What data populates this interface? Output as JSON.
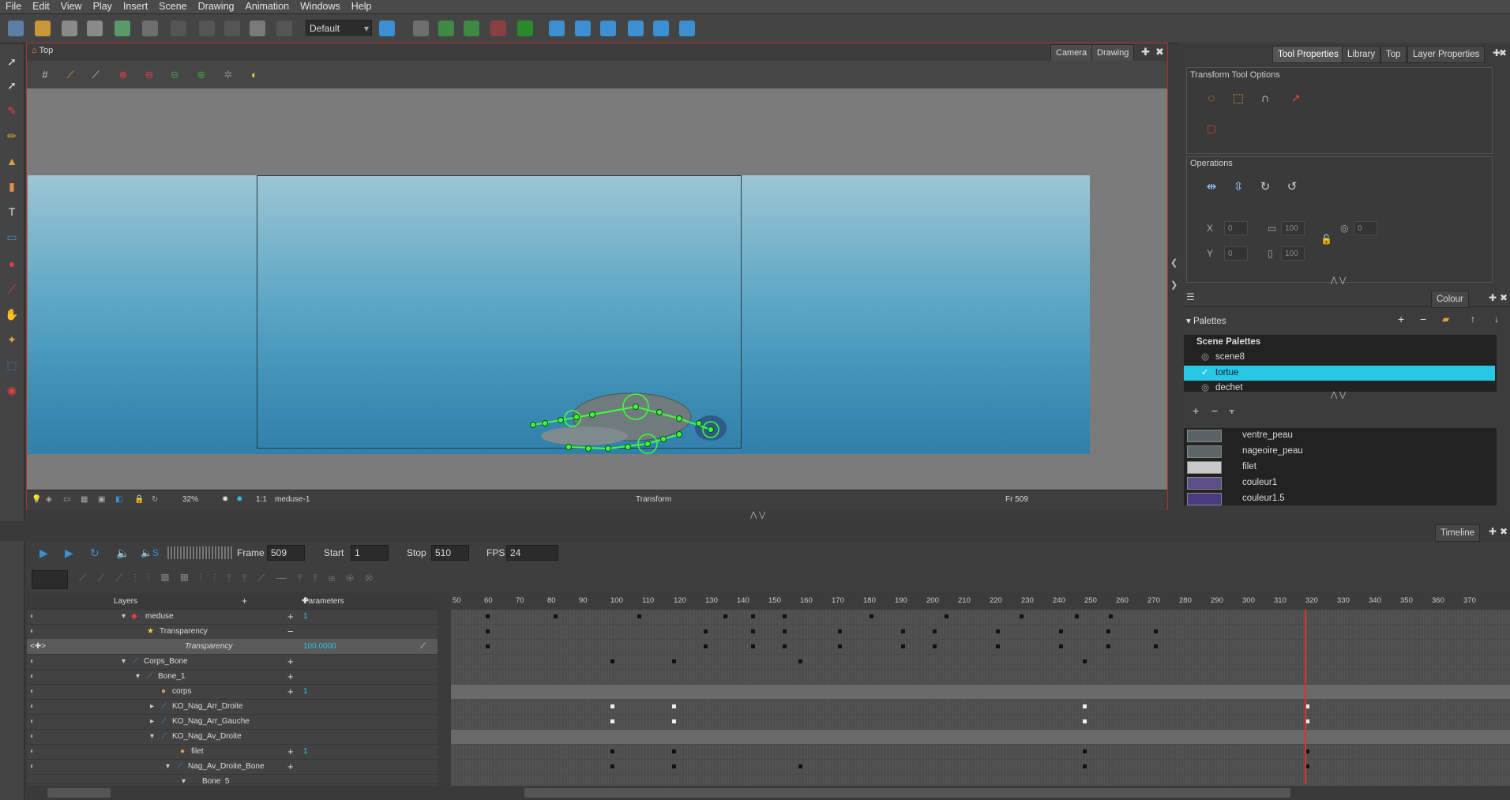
{
  "menu": [
    "File",
    "Edit",
    "View",
    "Play",
    "Insert",
    "Scene",
    "Drawing",
    "Animation",
    "Windows",
    "Help"
  ],
  "toolbar": {
    "workspace_select": "Default"
  },
  "view": {
    "title": "Top",
    "tabs": [
      "Camera",
      "Drawing"
    ],
    "status": {
      "zoom": "32%",
      "ratio": "1:1",
      "element": "meduse-1",
      "tool": "Transform",
      "frame": "Fr 509"
    }
  },
  "right_panel": {
    "tabs": [
      "Tool Properties",
      "Library",
      "Top",
      "Layer Properties"
    ],
    "transform_tool_options": "Transform Tool Options",
    "operations": "Operations",
    "fields": {
      "x": "0",
      "width": "100",
      "y": "0",
      "height": "100",
      "angle": "0"
    }
  },
  "colour": {
    "tab": "Colour",
    "palettes_label": "Palettes",
    "scene_palettes_label": "Scene Palettes",
    "palettes": [
      {
        "name": "scene8",
        "selected": false
      },
      {
        "name": "tortue",
        "selected": true
      },
      {
        "name": "dechet",
        "selected": false
      }
    ],
    "swatches": [
      {
        "name": "ventre_peau",
        "color": "#5a6466"
      },
      {
        "name": "nageoire_peau",
        "color": "#5c6567"
      },
      {
        "name": "filet",
        "color": "#c9c9c9"
      },
      {
        "name": "couleur1",
        "color": "#5d4e8a"
      },
      {
        "name": "couleur1.5",
        "color": "#4b3a7e"
      }
    ]
  },
  "timeline": {
    "tab": "Timeline",
    "frame_label": "Frame",
    "frame": "509",
    "start_label": "Start",
    "start": "1",
    "stop_label": "Stop",
    "stop": "510",
    "fps_label": "FPS",
    "fps": "24",
    "sound_label": "S",
    "layers_header": "Layers",
    "params_header": "Parameters",
    "layers": [
      {
        "name": "meduse",
        "param": "1"
      },
      {
        "name": "Transparency",
        "param": ""
      },
      {
        "name": "Transparency",
        "param": "100.0000"
      },
      {
        "name": "Corps_Bone",
        "param": ""
      },
      {
        "name": "Bone_1",
        "param": ""
      },
      {
        "name": "corps",
        "param": "1"
      },
      {
        "name": "KO_Nag_Arr_Droite",
        "param": ""
      },
      {
        "name": "KO_Nag_Arr_Gauche",
        "param": ""
      },
      {
        "name": "KO_Nag_Av_Droite",
        "param": ""
      },
      {
        "name": "filet",
        "param": "1"
      },
      {
        "name": "Nag_Av_Droite_Bone",
        "param": ""
      },
      {
        "name": "Bone_5",
        "param": ""
      }
    ],
    "ruler": [
      "50",
      "60",
      "70",
      "80",
      "90",
      "100",
      "110",
      "120",
      "130",
      "140",
      "150",
      "160",
      "170",
      "180",
      "190",
      "200",
      "210",
      "220",
      "230",
      "240",
      "250",
      "260",
      "270",
      "280",
      "290",
      "300",
      "310",
      "320",
      "330",
      "340",
      "350",
      "360",
      "370"
    ]
  },
  "colors": {
    "accent": "#29c7e6",
    "border_active": "#b03030"
  }
}
